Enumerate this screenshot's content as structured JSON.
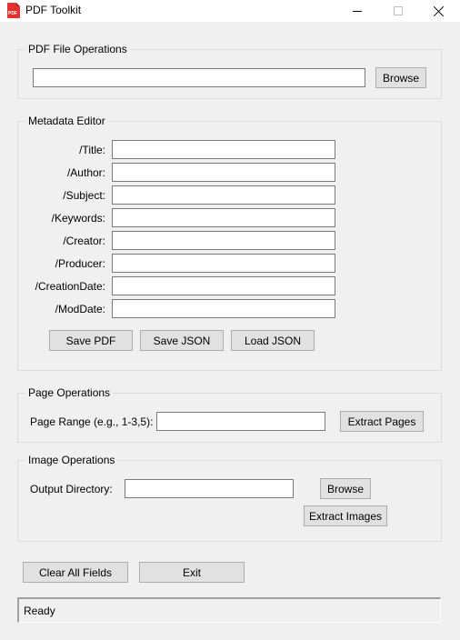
{
  "window": {
    "title": "PDF Toolkit"
  },
  "pdf_file": {
    "group_title": "PDF File Operations",
    "path_value": "",
    "browse_label": "Browse"
  },
  "metadata": {
    "group_title": "Metadata Editor",
    "fields": [
      {
        "label": "/Title:",
        "value": ""
      },
      {
        "label": "/Author:",
        "value": ""
      },
      {
        "label": "/Subject:",
        "value": ""
      },
      {
        "label": "/Keywords:",
        "value": ""
      },
      {
        "label": "/Creator:",
        "value": ""
      },
      {
        "label": "/Producer:",
        "value": ""
      },
      {
        "label": "/CreationDate:",
        "value": ""
      },
      {
        "label": "/ModDate:",
        "value": ""
      }
    ],
    "save_pdf_label": "Save PDF",
    "save_json_label": "Save JSON",
    "load_json_label": "Load JSON"
  },
  "page_ops": {
    "group_title": "Page Operations",
    "range_label": "Page Range (e.g., 1-3,5):",
    "range_value": "",
    "extract_label": "Extract Pages"
  },
  "image_ops": {
    "group_title": "Image Operations",
    "dir_label": "Output Directory:",
    "dir_value": "",
    "browse_label": "Browse",
    "extract_label": "Extract Images"
  },
  "actions": {
    "clear_label": "Clear All Fields",
    "exit_label": "Exit"
  },
  "status": {
    "text": "Ready"
  }
}
